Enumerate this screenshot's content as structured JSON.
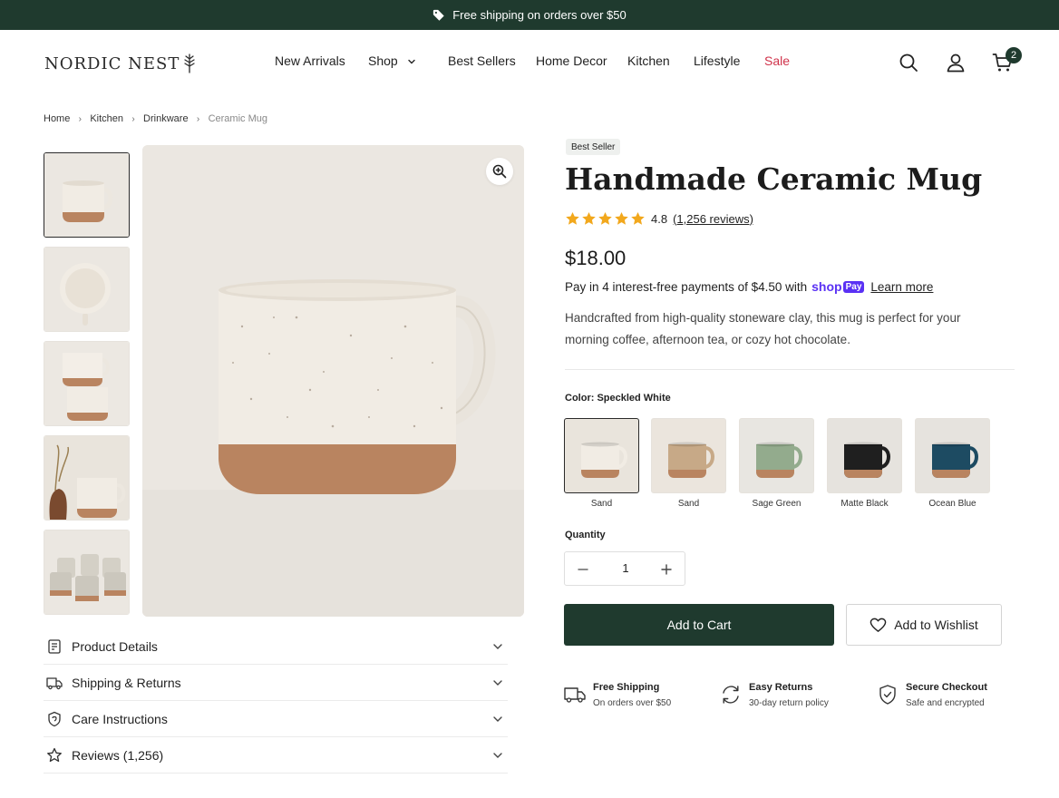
{
  "announcement": {
    "text": "Free shipping on orders over $50",
    "icon": "tag-icon"
  },
  "brand": {
    "name": "NORDIC NEST",
    "logo_icon": "leaf-icon"
  },
  "nav": {
    "items": [
      "New Arrivals",
      "Shop",
      "Best Sellers",
      "Home Decor",
      "Kitchen",
      "Lifestyle",
      "Sale"
    ],
    "sale_color": "#d0324a"
  },
  "header_icons": {
    "search": "search-icon",
    "account": "user-icon",
    "cart": "cart-icon",
    "cart_count": "2"
  },
  "breadcrumb": [
    "Home",
    "Kitchen",
    "Drinkware",
    "Ceramic Mug"
  ],
  "gallery": {
    "thumbnails": [
      "front view",
      "top view",
      "stacked mugs",
      "lifestyle with vase",
      "set of mugs"
    ],
    "active_index": 0
  },
  "accordion": [
    {
      "label": "Product Details",
      "icon": "document-icon"
    },
    {
      "label": "Shipping & Returns",
      "icon": "truck-icon"
    },
    {
      "label": "Care Instructions",
      "icon": "shield-icon"
    },
    {
      "label": "Reviews (1,256)",
      "icon": "star-outline-icon"
    }
  ],
  "product": {
    "badge": "Best Seller",
    "title": "Handmade Ceramic Mug",
    "rating": 4.8,
    "rating_text": "4.8",
    "reviews_text": "(1,256 reviews)",
    "stars": 5,
    "price": "$18.00",
    "installments_text": "Pay in 4 interest-free payments of $4.50 with",
    "shoppay_text": "shop",
    "shoppay_badge": "Pay",
    "learn_more": "Learn more",
    "description": "Handcrafted from high-quality stoneware clay, this mug is perfect for your morning coffee, afternoon tea, or cozy hot chocolate.",
    "color_label": "Color: Speckled White",
    "colors": [
      {
        "label": "Sand",
        "swatch": "#e9e4dc",
        "mug": "#f1ece4",
        "active": true
      },
      {
        "label": "Sand",
        "swatch": "#ebe5dd",
        "mug": "#c7a987",
        "active": false
      },
      {
        "label": "Sage Green",
        "swatch": "#e8e6e1",
        "mug": "#93ab8d",
        "active": false
      },
      {
        "label": "Matte Black",
        "swatch": "#e6e3de",
        "mug": "#1f1f1f",
        "active": false
      },
      {
        "label": "Ocean Blue",
        "swatch": "#e6e3de",
        "mug": "#1d4b62",
        "active": false
      }
    ],
    "quantity_label": "Quantity",
    "quantity": "1",
    "add_to_cart": "Add to Cart",
    "add_to_wishlist": "Add to Wishlist"
  },
  "features": [
    {
      "title": "Free Shipping",
      "subtitle": "On orders over $50",
      "icon": "truck-icon"
    },
    {
      "title": "Easy Returns",
      "subtitle": "30-day return policy",
      "icon": "refresh-icon"
    },
    {
      "title": "Secure Checkout",
      "subtitle": "Safe and encrypted",
      "icon": "shield-check-icon"
    }
  ],
  "colors": {
    "primary": "#1f3a2e",
    "star": "#f2a81d",
    "shoppay": "#5a31f4",
    "sale": "#d0324a"
  }
}
